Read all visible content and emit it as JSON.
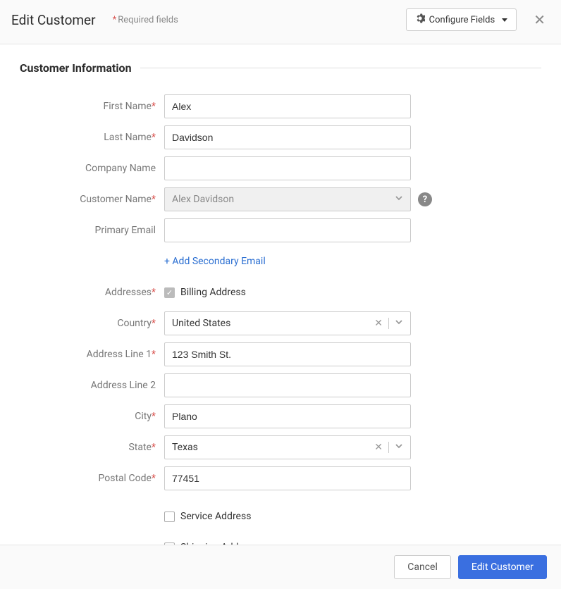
{
  "header": {
    "title": "Edit Customer",
    "required_note": "Required fields",
    "configure_button": "Configure Fields"
  },
  "section": {
    "title": "Customer Information"
  },
  "labels": {
    "first_name": "First Name",
    "last_name": "Last Name",
    "company_name": "Company Name",
    "customer_name": "Customer Name",
    "primary_email": "Primary Email",
    "add_secondary_email": "+ Add Secondary Email",
    "addresses": "Addresses",
    "billing_address": "Billing Address",
    "country": "Country",
    "address_line_1": "Address Line 1",
    "address_line_2": "Address Line 2",
    "city": "City",
    "state": "State",
    "postal_code": "Postal Code",
    "service_address": "Service Address",
    "shipping_address": "Shipping Address"
  },
  "values": {
    "first_name": "Alex",
    "last_name": "Davidson",
    "company_name": "",
    "customer_name": "Alex Davidson",
    "primary_email": "",
    "country": "United States",
    "address_line_1": "123 Smith St.",
    "address_line_2": "",
    "city": "Plano",
    "state": "Texas",
    "postal_code": "77451"
  },
  "footer": {
    "cancel": "Cancel",
    "submit": "Edit Customer"
  }
}
